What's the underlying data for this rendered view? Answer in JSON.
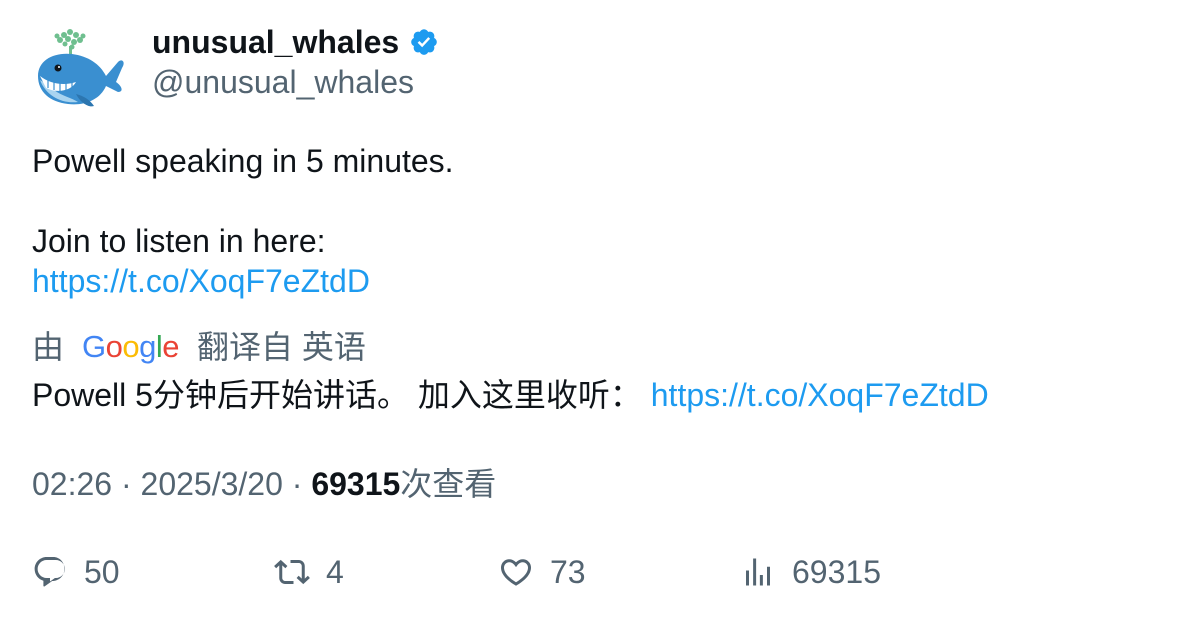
{
  "author": {
    "display_name": "unusual_whales",
    "handle": "@unusual_whales",
    "verified_color": "#1d9bf0"
  },
  "tweet": {
    "line1": "Powell speaking in 5 minutes.",
    "line2": "Join to listen in here:",
    "link": "https://t.co/XoqF7eZtdD"
  },
  "translation": {
    "prefix": "由",
    "provider_logo_text": "Google",
    "suffix": "翻译自 英语",
    "text": "Powell 5分钟后开始讲话。 加入这里收听：",
    "link": "https://t.co/XoqF7eZtdD"
  },
  "meta": {
    "time": "02:26",
    "separator1": " · ",
    "date": "2025/3/20",
    "separator2": " · ",
    "views_count": "69315",
    "views_label": "次查看"
  },
  "actions": {
    "replies": "50",
    "reposts": "4",
    "likes": "73",
    "views": "69315"
  },
  "icons": {
    "avatar": "whale-icon",
    "verified": "verified-badge-icon",
    "reply": "reply-icon",
    "repost": "repost-icon",
    "like": "heart-icon",
    "views": "bar-chart-icon"
  }
}
